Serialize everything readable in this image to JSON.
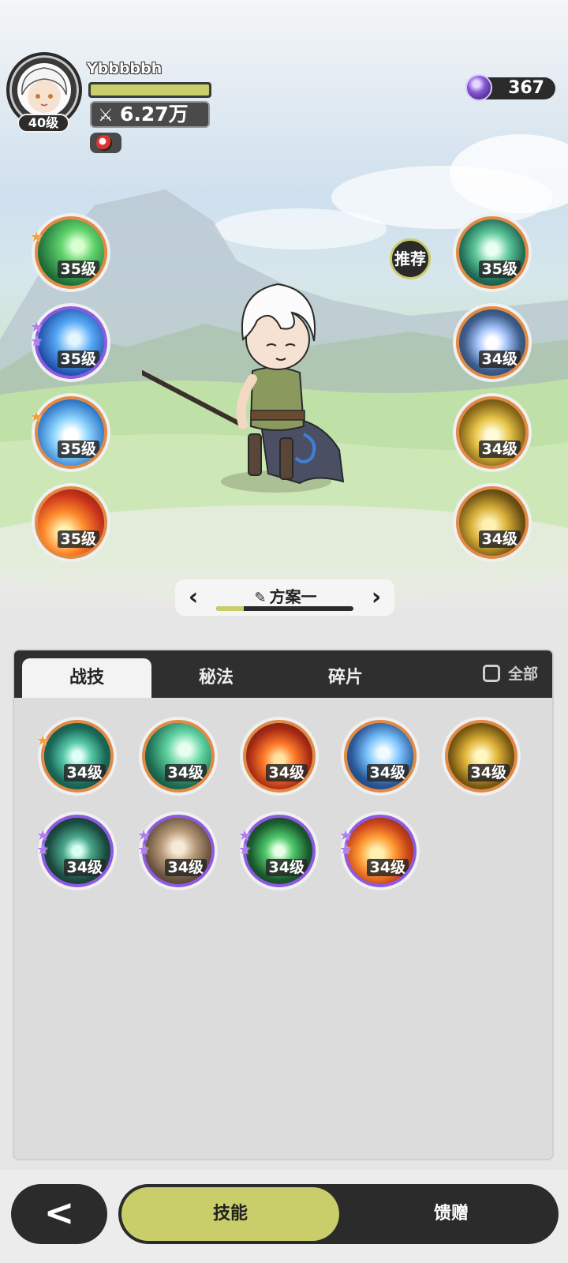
{
  "player": {
    "name": "Ybbbbbh",
    "level": "40级",
    "power": "6.27万",
    "hp_fraction": 1.0
  },
  "currency": {
    "gems": "367"
  },
  "recommend_label": "推荐",
  "equipped_left": [
    {
      "level": "35级",
      "icon": "green-wind-slash-icon",
      "star": "orange",
      "rarity": "orange"
    },
    {
      "level": "35级",
      "icon": "blue-water-wave-icon",
      "star": "purple",
      "rarity": "purple"
    },
    {
      "level": "35级",
      "icon": "ice-burst-icon",
      "star": "orange",
      "rarity": "orange"
    },
    {
      "level": "35级",
      "icon": "fire-flame-icon",
      "star": "",
      "rarity": "orange"
    }
  ],
  "equipped_right": [
    {
      "level": "35级",
      "icon": "green-shield-icon",
      "rarity": "orange"
    },
    {
      "level": "34级",
      "icon": "crystal-star-icon",
      "rarity": "orange"
    },
    {
      "level": "34级",
      "icon": "golden-light-icon",
      "rarity": "orange"
    },
    {
      "level": "34级",
      "icon": "golden-helmet-icon",
      "rarity": "orange"
    }
  ],
  "loadout": {
    "name": "方案一",
    "progress_fraction": 0.2
  },
  "tabs": [
    "战技",
    "秘法",
    "碎片"
  ],
  "active_tab": 0,
  "filter_all_label": "全部",
  "inventory": [
    {
      "level": "34级",
      "icon": "teal-vortex-icon",
      "star": "orange",
      "rarity": "orange"
    },
    {
      "level": "34级",
      "icon": "green-blade-icon",
      "star": "",
      "rarity": "orange"
    },
    {
      "level": "34级",
      "icon": "fire-swirl-icon",
      "star": "",
      "rarity": "orange"
    },
    {
      "level": "34级",
      "icon": "ice-crystal-icon",
      "star": "",
      "rarity": "orange"
    },
    {
      "level": "34级",
      "icon": "golden-crystal-icon",
      "star": "",
      "rarity": "orange"
    },
    {
      "level": "34级",
      "icon": "thorn-vine-icon",
      "star": "purple",
      "rarity": "purple"
    },
    {
      "level": "34级",
      "icon": "rock-talisman-icon",
      "star": "purple",
      "rarity": "purple"
    },
    {
      "level": "34级",
      "icon": "green-heal-cross-icon",
      "star": "purple",
      "rarity": "purple"
    },
    {
      "level": "34级",
      "icon": "fire-orb-icon",
      "star": "purple",
      "rarity": "purple"
    }
  ],
  "bottom_nav": {
    "back_glyph": "<",
    "skill_label": "技能",
    "gift_label": "馈赠"
  },
  "colors": {
    "accent": "#c9cd6a",
    "dark": "#2b2b2b",
    "rarity_orange": "#e08a46",
    "rarity_purple": "#8d5ae0"
  }
}
